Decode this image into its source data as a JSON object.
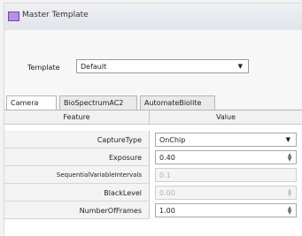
{
  "window": {
    "title": "Master Template",
    "icon": "app-icon"
  },
  "template": {
    "label": "Template",
    "value": "Default"
  },
  "tabs": [
    "Camera",
    "BioSpectrumAC2",
    "AutomateBiolite"
  ],
  "grid": {
    "headers": {
      "feature": "Feature",
      "value": "Value"
    },
    "rows": [
      {
        "feature": "CaptureType",
        "value": "OnChip",
        "control": "dropdown",
        "enabled": true
      },
      {
        "feature": "Exposure",
        "value": "0.40",
        "control": "spinner",
        "enabled": true
      },
      {
        "feature": "SequentialVariableIntervals",
        "value": "0.1",
        "control": "text",
        "enabled": false
      },
      {
        "feature": "BlackLevel",
        "value": "0.00",
        "control": "spinner",
        "enabled": false
      },
      {
        "feature": "NumberOfFrames",
        "value": "1.00",
        "control": "spinner",
        "enabled": true
      }
    ]
  }
}
